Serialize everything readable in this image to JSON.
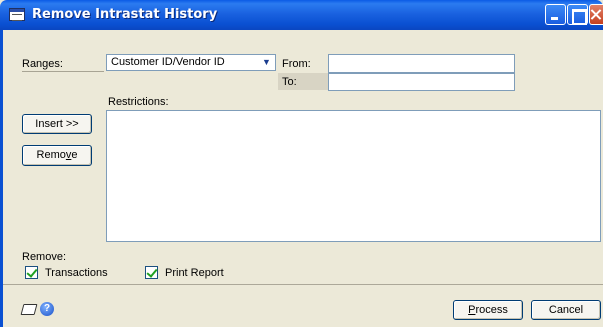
{
  "window": {
    "title": "Remove Intrastat History"
  },
  "ranges": {
    "label": "Ranges:",
    "selected": "Customer ID/Vendor ID",
    "from_label": "From:",
    "to_label": "To:",
    "from_value": "",
    "to_value": ""
  },
  "restrictions": {
    "label": "Restrictions:",
    "insert_label": "Insert >>",
    "remove_label_pre": "Remo",
    "remove_label_ul": "v",
    "remove_label_post": "e"
  },
  "remove_section": {
    "label": "Remove:",
    "options": [
      {
        "label": "Transactions",
        "checked": true
      },
      {
        "label": "Print Report",
        "checked": true
      }
    ]
  },
  "footer": {
    "process_ul": "P",
    "process_rest": "rocess",
    "cancel_label": "Cancel"
  },
  "colors": {
    "titlebar": "#0a5ae6",
    "dialog_bg": "#ece9d8",
    "close_button": "#c5401f"
  }
}
